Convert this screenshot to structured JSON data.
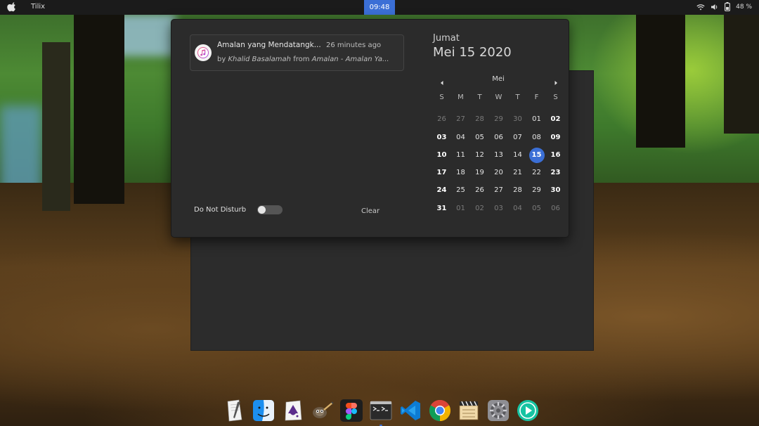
{
  "topbar": {
    "app_name": "Tilix",
    "clock": "09:48",
    "battery_percent": "48 %"
  },
  "notification": {
    "title": "Amalan yang Mendatangk...",
    "time": "26 minutes ago",
    "by_prefix": "by",
    "artist": "Khalid Basalamah",
    "from_text": "from",
    "album": "Amalan - Amalan Ya..."
  },
  "do_not_disturb": {
    "label": "Do Not Disturb",
    "enabled": false
  },
  "clear_label": "Clear",
  "calendar": {
    "day_name": "Jumat",
    "full_date": "Mei 15 2020",
    "month_label": "Mei",
    "weekday_headers": [
      "S",
      "M",
      "T",
      "W",
      "T",
      "F",
      "S"
    ],
    "today": 15,
    "weeks": [
      [
        "26",
        "27",
        "28",
        "29",
        "30",
        "01",
        "02"
      ],
      [
        "03",
        "04",
        "05",
        "06",
        "07",
        "08",
        "09"
      ],
      [
        "10",
        "11",
        "12",
        "13",
        "14",
        "15",
        "16"
      ],
      [
        "17",
        "18",
        "19",
        "20",
        "21",
        "22",
        "23"
      ],
      [
        "24",
        "25",
        "26",
        "27",
        "28",
        "29",
        "30"
      ],
      [
        "31",
        "01",
        "02",
        "03",
        "04",
        "05",
        "06"
      ]
    ]
  },
  "dock": {
    "items": [
      {
        "name": "text-editor-icon"
      },
      {
        "name": "finder-icon"
      },
      {
        "name": "inkscape-icon"
      },
      {
        "name": "gimp-icon"
      },
      {
        "name": "figma-icon"
      },
      {
        "name": "terminal-icon",
        "running": true
      },
      {
        "name": "vscode-icon"
      },
      {
        "name": "chrome-icon"
      },
      {
        "name": "clapper-icon"
      },
      {
        "name": "settings-icon"
      },
      {
        "name": "media-player-icon"
      }
    ]
  },
  "colors": {
    "accent": "#3b6fd6",
    "panel": "#2b2b2b",
    "topbar": "#1b1b1b"
  }
}
